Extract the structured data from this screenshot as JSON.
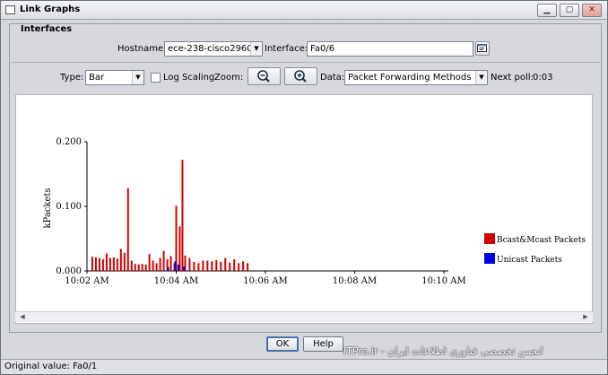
{
  "window": {
    "title": "Link Graphs"
  },
  "interfaces_group": {
    "title": "Interfaces",
    "hostname_label": "Hostname:",
    "hostname_value": "ece-238-cisco2960",
    "interface_label": "Interface:",
    "interface_value": "Fa0/6"
  },
  "toolbar": {
    "type_label": "Type:",
    "type_value": "Bar",
    "log_scaling_label": "Log Scaling",
    "log_scaling_checked": false,
    "zoom_label": "Zoom:",
    "data_label": "Data:",
    "data_value": "Packet Forwarding Methods",
    "next_poll_label": "Next poll:",
    "next_poll_value": "0:03"
  },
  "buttons": {
    "ok": "OK",
    "help": "Help"
  },
  "status": {
    "text": "Original value: Fa0/1"
  },
  "watermark": "ITPro.ir - انجمن تخصصی فناوری اطلاعات ایران",
  "icons": [
    "app-window-icon",
    "minimize-icon",
    "maximize-icon",
    "close-icon",
    "browse-icon",
    "zoom-out-icon",
    "zoom-in-icon",
    "chevron-down-icon"
  ],
  "chart_data": {
    "type": "bar",
    "title": "",
    "xlabel": "",
    "ylabel": "kPackets",
    "ylim": [
      0,
      0.2
    ],
    "yticks": [
      "0.000",
      "0.100",
      "0.200"
    ],
    "xticks": [
      "10:02 AM",
      "10:04 AM",
      "10:06 AM",
      "10:08 AM",
      "10:10 AM"
    ],
    "x_unit": "minutes after 10:00 AM",
    "xlim": [
      2,
      10.1
    ],
    "legend_position": "right",
    "grid": false,
    "series": [
      {
        "name": "Bcast&Mcast Packets",
        "color": "#d00000",
        "points": [
          [
            2.12,
            0.022
          ],
          [
            2.2,
            0.021
          ],
          [
            2.28,
            0.02
          ],
          [
            2.36,
            0.018
          ],
          [
            2.44,
            0.027
          ],
          [
            2.52,
            0.02
          ],
          [
            2.6,
            0.021
          ],
          [
            2.68,
            0.019
          ],
          [
            2.76,
            0.034
          ],
          [
            2.84,
            0.028
          ],
          [
            2.92,
            0.128
          ],
          [
            3.0,
            0.016
          ],
          [
            3.08,
            0.011
          ],
          [
            3.16,
            0.01
          ],
          [
            3.24,
            0.011
          ],
          [
            3.32,
            0.01
          ],
          [
            3.4,
            0.026
          ],
          [
            3.48,
            0.016
          ],
          [
            3.56,
            0.012
          ],
          [
            3.64,
            0.02
          ],
          [
            3.72,
            0.031
          ],
          [
            3.8,
            0.018
          ],
          [
            3.88,
            0.023
          ],
          [
            3.96,
            0.012
          ],
          [
            4.0,
            0.101
          ],
          [
            4.08,
            0.069
          ],
          [
            4.14,
            0.172
          ],
          [
            4.2,
            0.024
          ],
          [
            4.3,
            0.02
          ],
          [
            4.4,
            0.014
          ],
          [
            4.5,
            0.012
          ],
          [
            4.6,
            0.016
          ],
          [
            4.7,
            0.016
          ],
          [
            4.8,
            0.015
          ],
          [
            4.9,
            0.017
          ],
          [
            5.0,
            0.014
          ],
          [
            5.1,
            0.02
          ],
          [
            5.2,
            0.013
          ],
          [
            5.3,
            0.018
          ],
          [
            5.4,
            0.012
          ],
          [
            5.5,
            0.015
          ],
          [
            5.6,
            0.012
          ]
        ]
      },
      {
        "name": "Unicast Packets",
        "color": "#0000e0",
        "points": [
          [
            3.82,
            0.006
          ],
          [
            3.98,
            0.015
          ],
          [
            4.05,
            0.01
          ],
          [
            4.18,
            0.007
          ]
        ]
      }
    ]
  }
}
